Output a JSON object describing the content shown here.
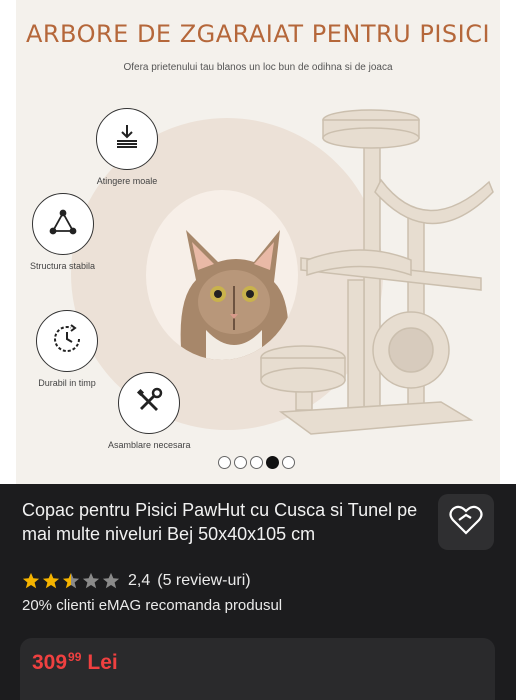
{
  "banner": {
    "title": "ARBORE DE ZGARAIAT PENTRU PISICI",
    "subtitle": "Ofera prietenului tau blanos un loc bun de odihna si de joaca",
    "features": [
      {
        "icon": "download-icon",
        "label": "Atingere moale"
      },
      {
        "icon": "triangle-icon",
        "label": "Structura stabila"
      },
      {
        "icon": "clock-icon",
        "label": "Durabil in timp"
      },
      {
        "icon": "tools-icon",
        "label": "Asamblare necesara"
      }
    ]
  },
  "gallery": {
    "active_index": 3,
    "count": 5
  },
  "product": {
    "title": "Copac pentru Pisici PawHut cu Cusca si Tunel pe mai multe niveluri Bej 50x40x105 cm",
    "rating_value": 2.4,
    "rating_text": "2,4",
    "reviews_text": "(5 review-uri)",
    "recommend_text": "20% clienti eMAG recomanda produsul",
    "price_main": "309",
    "price_cents": "99",
    "currency": "Lei"
  },
  "colors": {
    "accent_price": "#ef4040",
    "star": "#f5b400",
    "title_brown": "#b5673a"
  }
}
